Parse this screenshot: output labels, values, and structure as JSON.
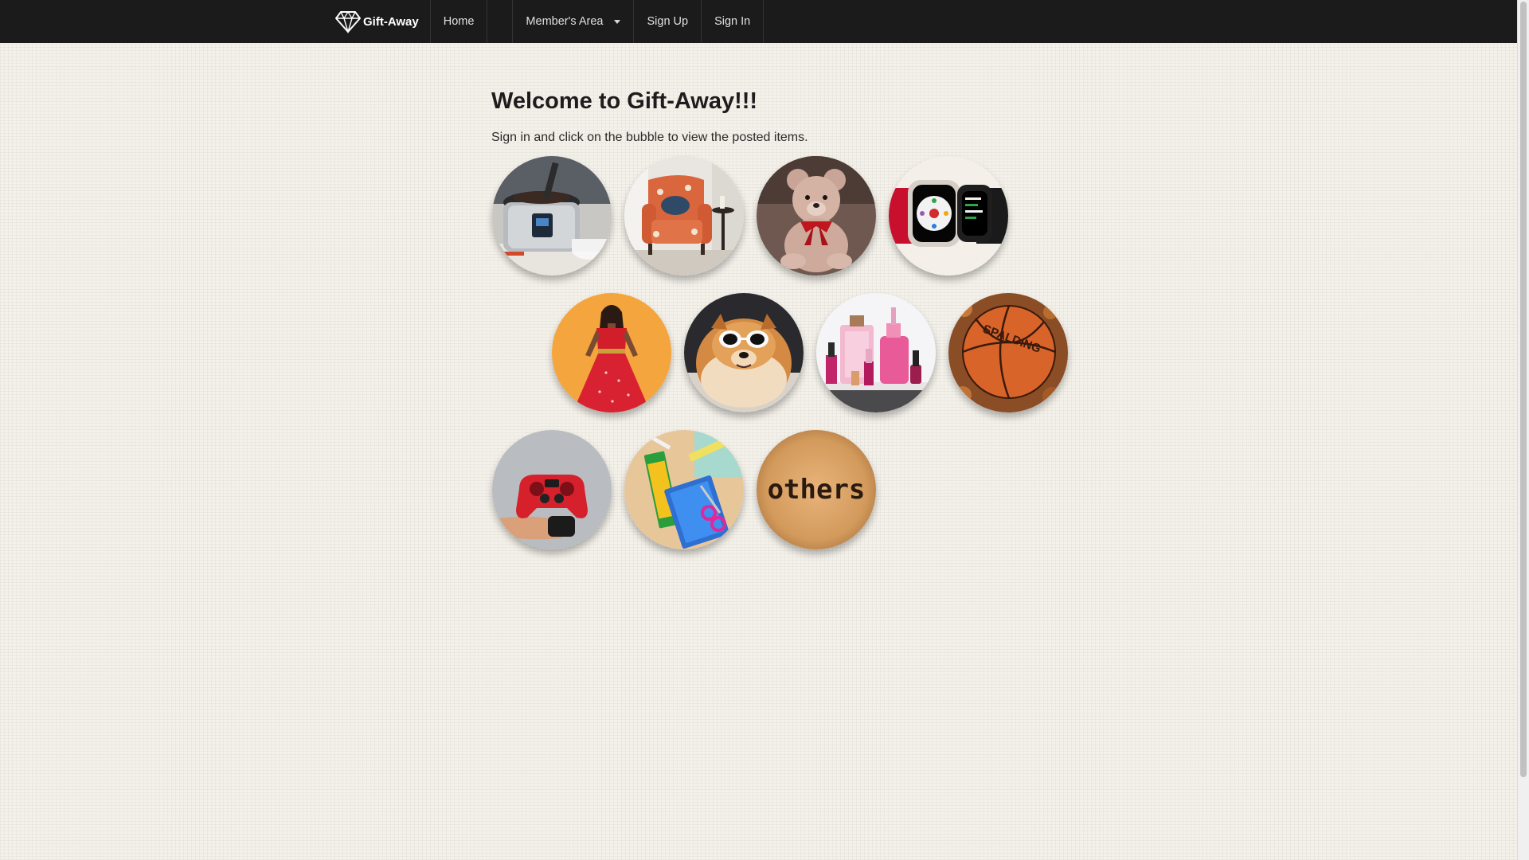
{
  "nav": {
    "brand": "Gift-Away",
    "home": "Home",
    "members_area": "Member's Area",
    "sign_up": "Sign Up",
    "sign_in": "Sign In"
  },
  "main": {
    "title": "Welcome to Gift-Away!!!",
    "subtitle": "Sign in and click on the bubble to view the posted items.",
    "bubbles": [
      {
        "icon": "pressure-cooker-icon"
      },
      {
        "icon": "armchair-icon"
      },
      {
        "icon": "teddy-bear-icon"
      },
      {
        "icon": "smartwatch-icon"
      },
      {
        "icon": "red-dress-icon"
      },
      {
        "icon": "dog-icon"
      },
      {
        "icon": "cosmetics-icon"
      },
      {
        "icon": "basketball-icon",
        "label": "SPALDING"
      },
      {
        "icon": "game-controller-icon"
      },
      {
        "icon": "school-supplies-icon"
      },
      {
        "icon": "others-icon",
        "label": "others"
      }
    ]
  }
}
